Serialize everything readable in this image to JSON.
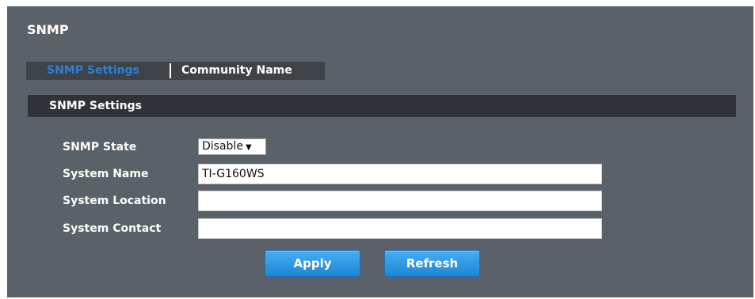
{
  "page": {
    "title": "SNMP"
  },
  "tabs": [
    {
      "label": "SNMP Settings",
      "active": true
    },
    {
      "label": "Community Name",
      "active": false
    }
  ],
  "section": {
    "title": "SNMP Settings"
  },
  "form": {
    "snmp_state": {
      "label": "SNMP State",
      "value": "Disable",
      "options": [
        "Disable"
      ]
    },
    "system_name": {
      "label": "System Name",
      "value": "TI-G160WS"
    },
    "system_location": {
      "label": "System Location",
      "value": ""
    },
    "system_contact": {
      "label": "System Contact",
      "value": ""
    }
  },
  "buttons": {
    "apply": "Apply",
    "refresh": "Refresh"
  },
  "colors": {
    "panel_bg": "#5b6168",
    "tab_bar_bg": "#3e4348",
    "section_bar_bg": "#2f3338",
    "active_tab_text": "#2d7fd6",
    "button_blue": "#1e86d4"
  }
}
